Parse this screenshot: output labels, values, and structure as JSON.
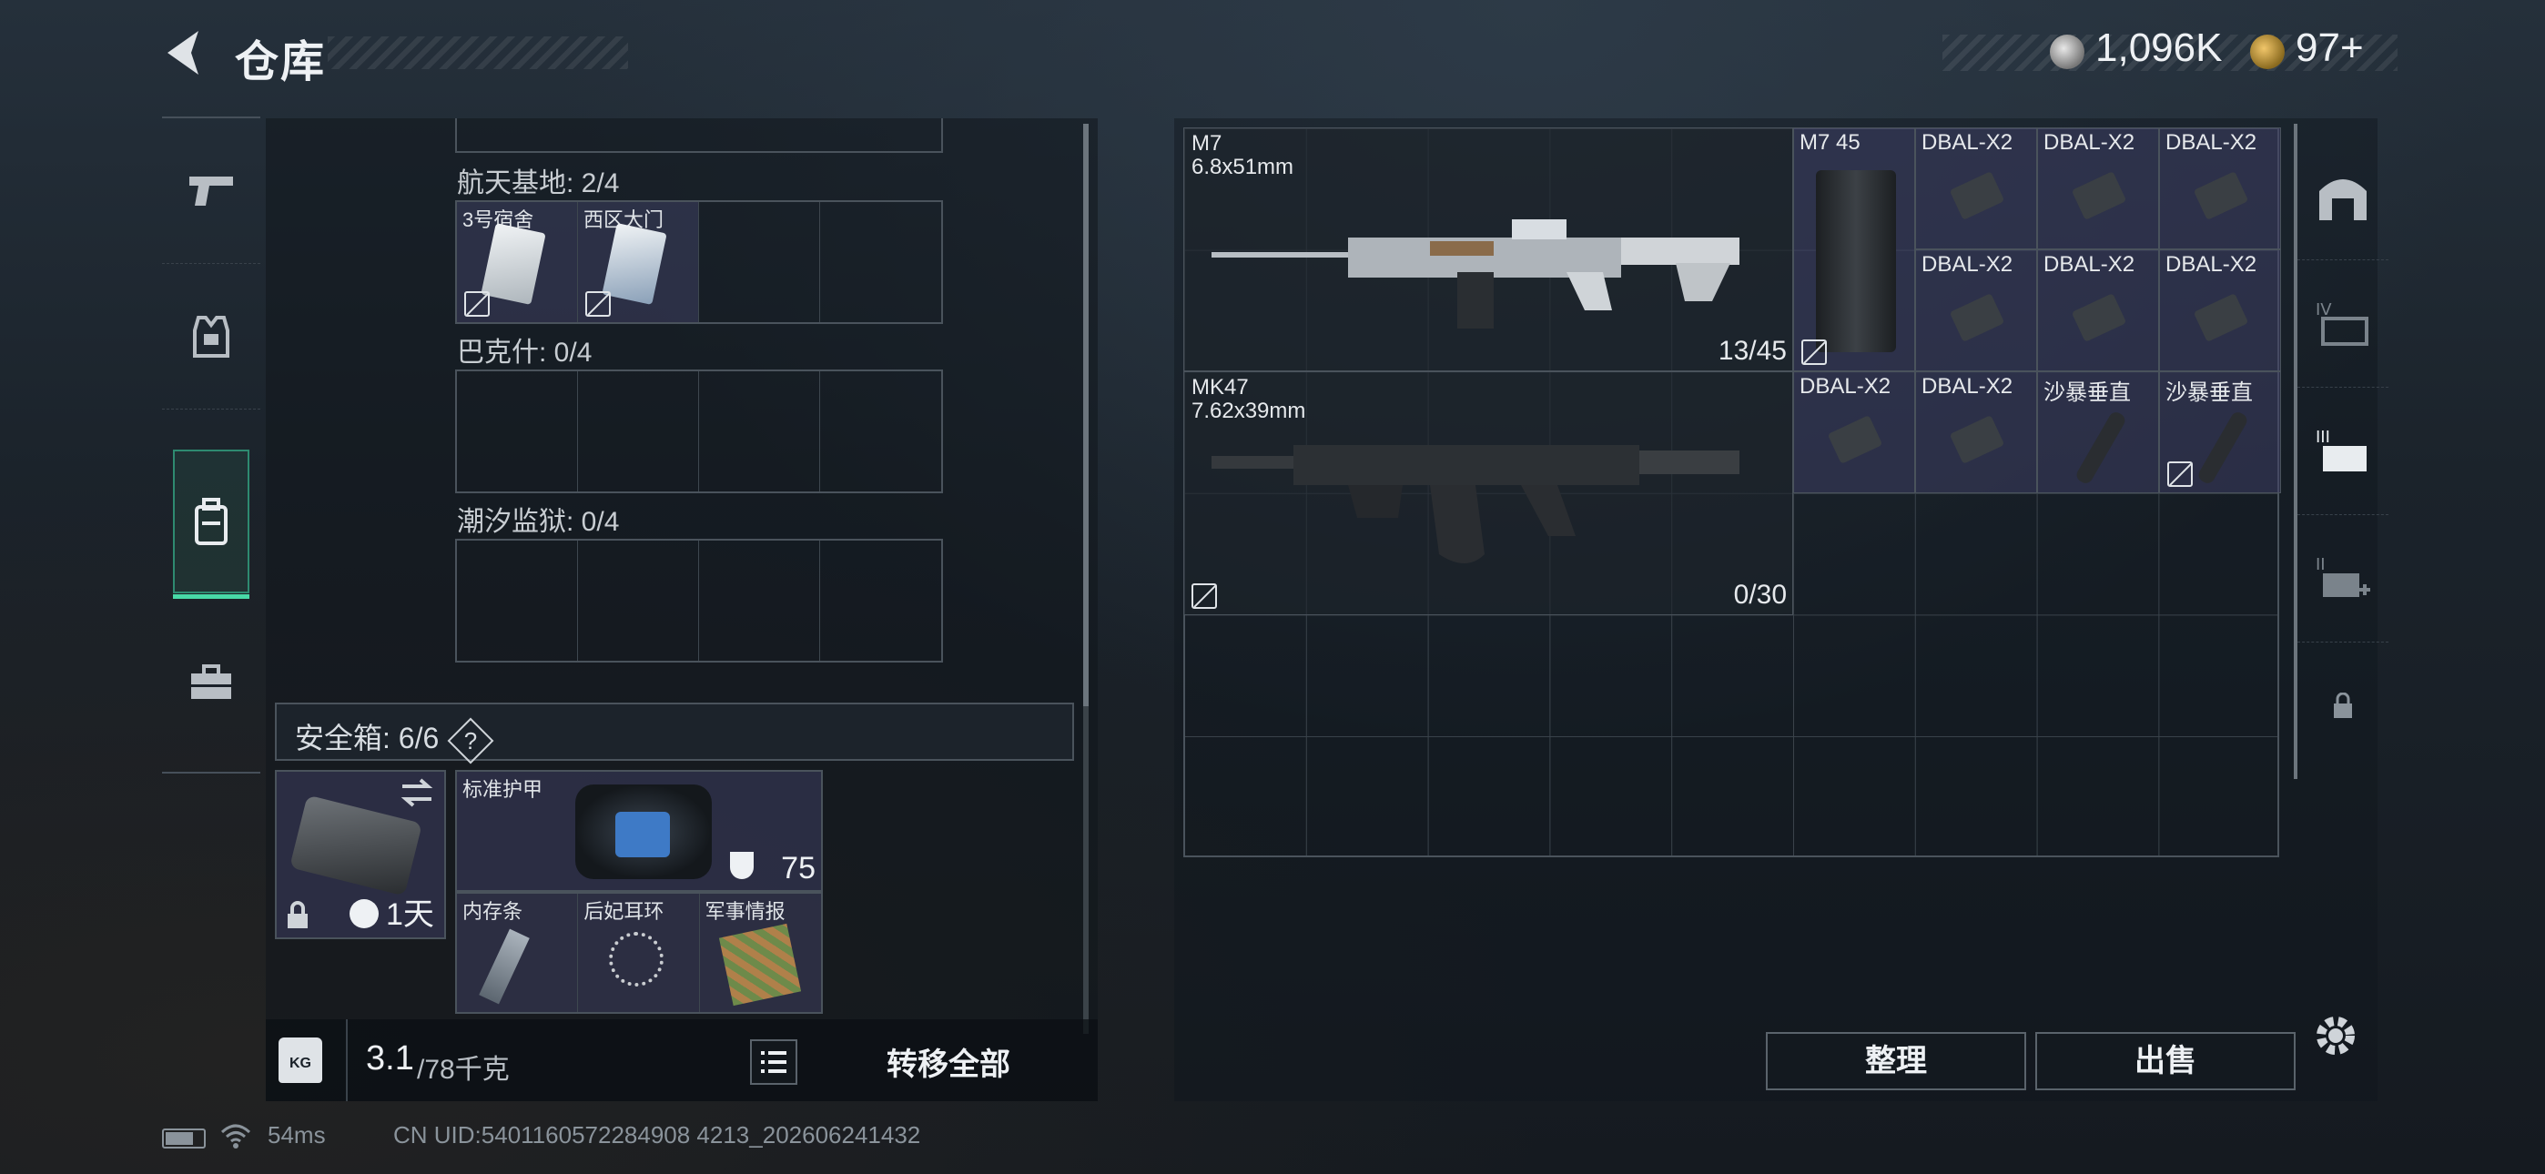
{
  "header": {
    "title": "仓库",
    "currency1": "1,096K",
    "currency2": "97+"
  },
  "left_nav": {
    "items": [
      "firearms",
      "armor",
      "backpack-active",
      "briefcase"
    ]
  },
  "containers": [
    {
      "label": "航天基地: 2/4",
      "items": [
        {
          "name": "3号宿舍"
        },
        {
          "name": "西区大门"
        },
        {
          "name": ""
        },
        {
          "name": ""
        }
      ]
    },
    {
      "label": "巴克什: 0/4"
    },
    {
      "label": "潮汐监狱: 0/4"
    }
  ],
  "safebox": {
    "label": "安全箱:",
    "count": "6/6",
    "help": "?",
    "timer": "1天"
  },
  "armor": {
    "name": "标准护甲",
    "durability": "75"
  },
  "safe_items": [
    {
      "name": "内存条"
    },
    {
      "name": "后妃耳环"
    },
    {
      "name": "军事情报"
    }
  ],
  "weight": {
    "current": "3.1",
    "max": "/78千克",
    "kg_icon": "KG"
  },
  "transfer_all": "转移全部",
  "stash": {
    "weapons": [
      {
        "name": "M7",
        "caliber": "6.8x51mm",
        "ammo": "13/45"
      },
      {
        "name": "MK47",
        "caliber": "7.62x39mm",
        "ammo": "0/30"
      }
    ],
    "mag": {
      "name": "M7 45"
    },
    "attachments": [
      "DBAL-X2",
      "DBAL-X2",
      "DBAL-X2",
      "DBAL-X2",
      "DBAL-X2",
      "DBAL-X2",
      "DBAL-X2",
      "DBAL-X2"
    ],
    "grips": [
      "沙暴垂直",
      "沙暴垂直"
    ]
  },
  "buttons": {
    "sort": "整理",
    "sell": "出售"
  },
  "footer": {
    "ping": "54ms",
    "uid": "CN UID:5401160572284908 4213_202606241432"
  },
  "colors": {
    "accent": "#48d9a7",
    "item_bg": "#40406a"
  }
}
